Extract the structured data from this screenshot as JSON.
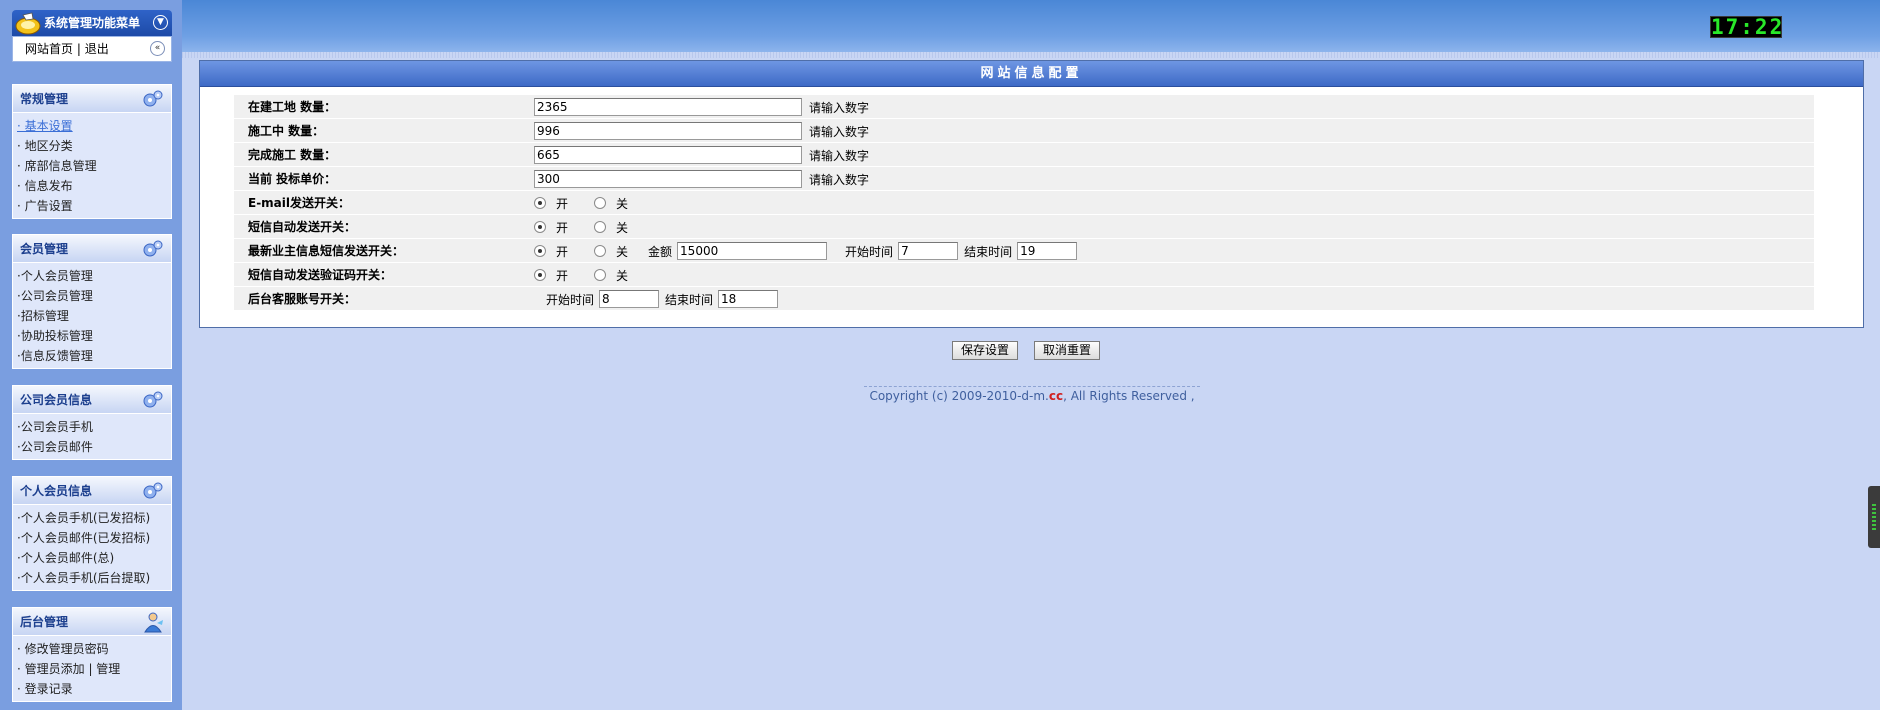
{
  "menu": {
    "title": "系统管理功能菜单",
    "home_link": "网站首页",
    "separator": "|",
    "logout_link": "退出",
    "toggle_icon": "chevron-down-circle-icon",
    "collapse_icon": "double-chevron-left-icon"
  },
  "groups": [
    {
      "title": "常规管理",
      "icon": "gears-icon",
      "items": [
        "· 基本设置",
        "· 地区分类",
        "· 席部信息管理",
        "· 信息发布",
        "· 广告设置"
      ]
    },
    {
      "title": "会员管理",
      "icon": "gears-icon",
      "items": [
        "·个人会员管理",
        "·公司会员管理",
        "·招标管理",
        "·协助投标管理",
        "·信息反馈管理"
      ]
    },
    {
      "title": "公司会员信息",
      "icon": "gears-icon",
      "items": [
        "·公司会员手机",
        "·公司会员邮件"
      ]
    },
    {
      "title": "个人会员信息",
      "icon": "gears-icon",
      "items": [
        "·个人会员手机(已发招标)",
        "·个人会员邮件(已发招标)",
        "·个人会员邮件(总)",
        "·个人会员手机(后台提取)"
      ]
    },
    {
      "title": "后台管理",
      "icon": "user-icon",
      "items": [
        "· 修改管理员密码",
        "· 管理员添加 | 管理",
        "· 登录记录"
      ]
    }
  ],
  "clock": "17:22",
  "panel": {
    "title": "网站信息配置",
    "rows": {
      "sites": {
        "label": "在建工地 数量：",
        "value": "2365",
        "hint": "请输入数字"
      },
      "working": {
        "label": "施工中 数量：",
        "value": "996",
        "hint": "请输入数字"
      },
      "done": {
        "label": "完成施工 数量：",
        "value": "665",
        "hint": "请输入数字"
      },
      "price": {
        "label": "当前 投标单价：",
        "value": "300",
        "hint": "请输入数字"
      },
      "email": {
        "label": "E-mail发送开关：",
        "on": "开",
        "off": "关",
        "selected": "on"
      },
      "sms": {
        "label": "短信自动发送开关：",
        "on": "开",
        "off": "关",
        "selected": "on"
      },
      "owner_sms": {
        "label": "最新业主信息短信发送开关：",
        "on": "开",
        "off": "关",
        "selected": "on",
        "amount_label": "金额",
        "amount": "15000",
        "start_label": "开始时间",
        "start": "7",
        "end_label": "结束时间",
        "end": "19"
      },
      "verify_sms": {
        "label": "短信自动发送验证码开关：",
        "on": "开",
        "off": "关",
        "selected": "on"
      },
      "service": {
        "label": "后台客服账号开关：",
        "start_label": "开始时间",
        "start": "8",
        "end_label": "结束时间",
        "end": "18"
      }
    }
  },
  "buttons": {
    "save": "保存设置",
    "reset": "取消重置"
  },
  "footer": {
    "prefix": "Copyright (c) 2009-2010-d-m.",
    "brand": "cc",
    "suffix": ", All Rights Reserved ,"
  }
}
